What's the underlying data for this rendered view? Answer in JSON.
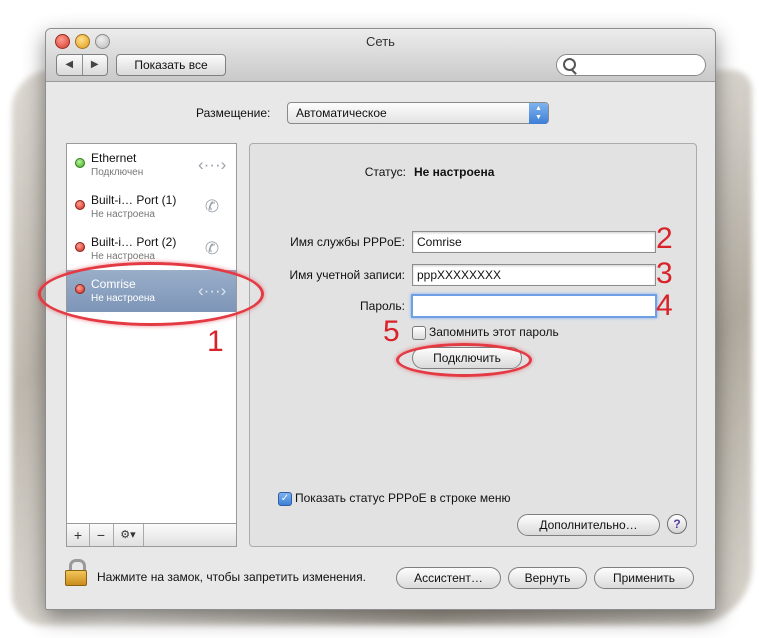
{
  "window": {
    "title": "Сеть",
    "show_all_label": "Показать все",
    "nav_back": "◀",
    "nav_forward": "▶"
  },
  "location": {
    "label": "Размещение:",
    "value": "Автоматическое"
  },
  "services": [
    {
      "name": "Ethernet",
      "status": "Подключен",
      "status_color": "green",
      "icon": "ethernet-arrows-icon"
    },
    {
      "name": "Built-i… Port (1)",
      "status": "Не настроена",
      "status_color": "red",
      "icon": "phone-icon"
    },
    {
      "name": "Built-i… Port (2)",
      "status": "Не настроена",
      "status_color": "red",
      "icon": "phone-icon"
    },
    {
      "name": "Comrise",
      "status": "Не настроена",
      "status_color": "red",
      "icon": "ethernet-arrows-icon",
      "selected": true
    }
  ],
  "sidebar_controls": {
    "add": "+",
    "remove": "−",
    "gear": "⚙▾"
  },
  "panel": {
    "status_label": "Статус:",
    "status_value": "Не настроена",
    "service_name_label": "Имя службы PPPoE:",
    "service_name_value": "Comrise",
    "account_label": "Имя учетной записи:",
    "account_value": "pppXXXXXXXX",
    "password_label": "Пароль:",
    "password_value": "",
    "remember_label": "Запомнить этот пароль",
    "connect_label": "Подключить",
    "show_status_label": "Показать статус PPPoE в строке меню",
    "show_status_checked": true,
    "advanced_label": "Дополнительно…",
    "help_label": "?"
  },
  "footer": {
    "lock_text": "Нажмите на замок, чтобы запретить изменения.",
    "assistant_label": "Ассистент…",
    "revert_label": "Вернуть",
    "apply_label": "Применить"
  },
  "annotations": [
    "1",
    "2",
    "3",
    "4",
    "5"
  ],
  "colors": {
    "annotation_red": "#d8232a",
    "selection_blue": "#7d95b8",
    "accent_blue": "#3d7fd6"
  }
}
